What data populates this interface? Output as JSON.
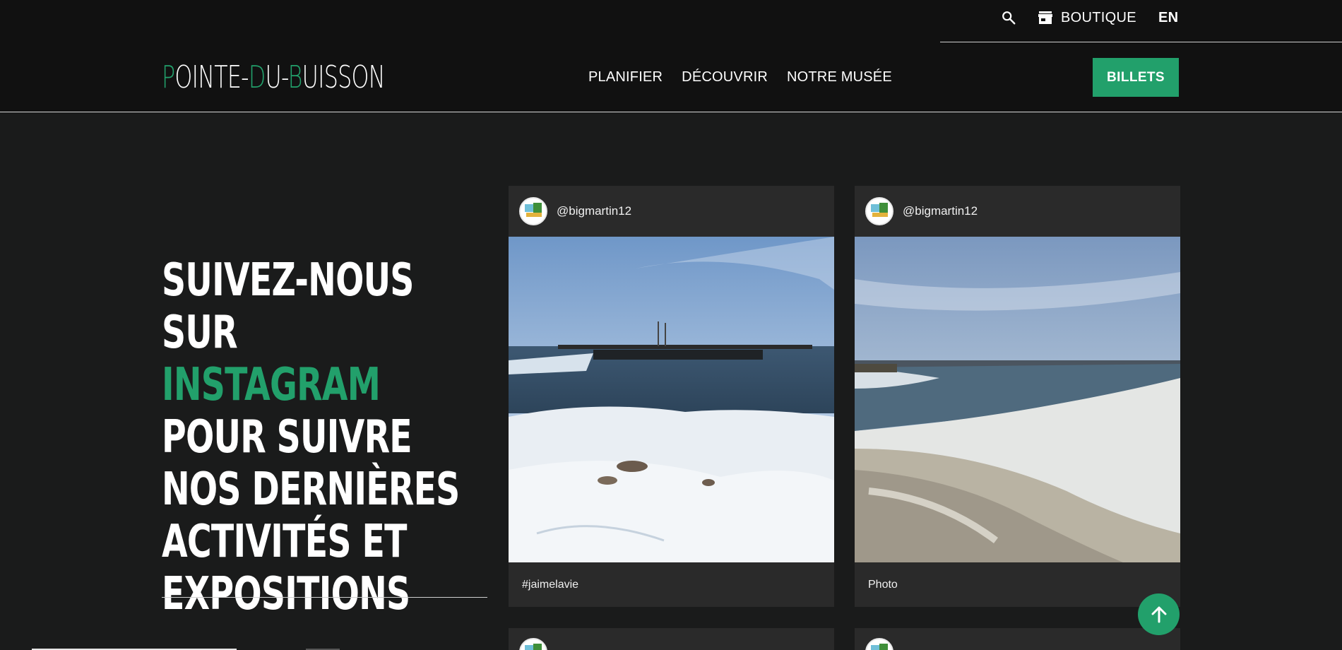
{
  "header": {
    "logo": {
      "p1": "P",
      "p2": "OINTE-",
      "p3": "D",
      "p4": "U-",
      "p5": "B",
      "p6": "UISSON"
    },
    "utility": {
      "shop_label": "BOUTIQUE",
      "lang_label": "EN",
      "search_icon": "search-icon",
      "shop_icon": "store-icon"
    },
    "nav": [
      {
        "label": "PLANIFIER"
      },
      {
        "label": "DÉCOUVRIR"
      },
      {
        "label": "NOTRE MUSÉE"
      }
    ],
    "cta_label": "BILLETS"
  },
  "section": {
    "heading_line1": "SUIVEZ-NOUS SUR",
    "heading_accent": "INSTAGRAM",
    "heading_rest": " POUR SUIVRE NOS DERNIÈRES ACTIVITÉS ET EXPOSITIONS"
  },
  "posts": [
    {
      "handle": "@bigmartin12",
      "caption": "#jaimelavie"
    },
    {
      "handle": "@bigmartin12",
      "caption": "Photo"
    }
  ],
  "colors": {
    "accent": "#22a06b",
    "header_bg": "#111111",
    "page_bg": "#1a1b1b",
    "card_bg": "#2a2a2a"
  },
  "fab_icon": "arrow-up-icon"
}
